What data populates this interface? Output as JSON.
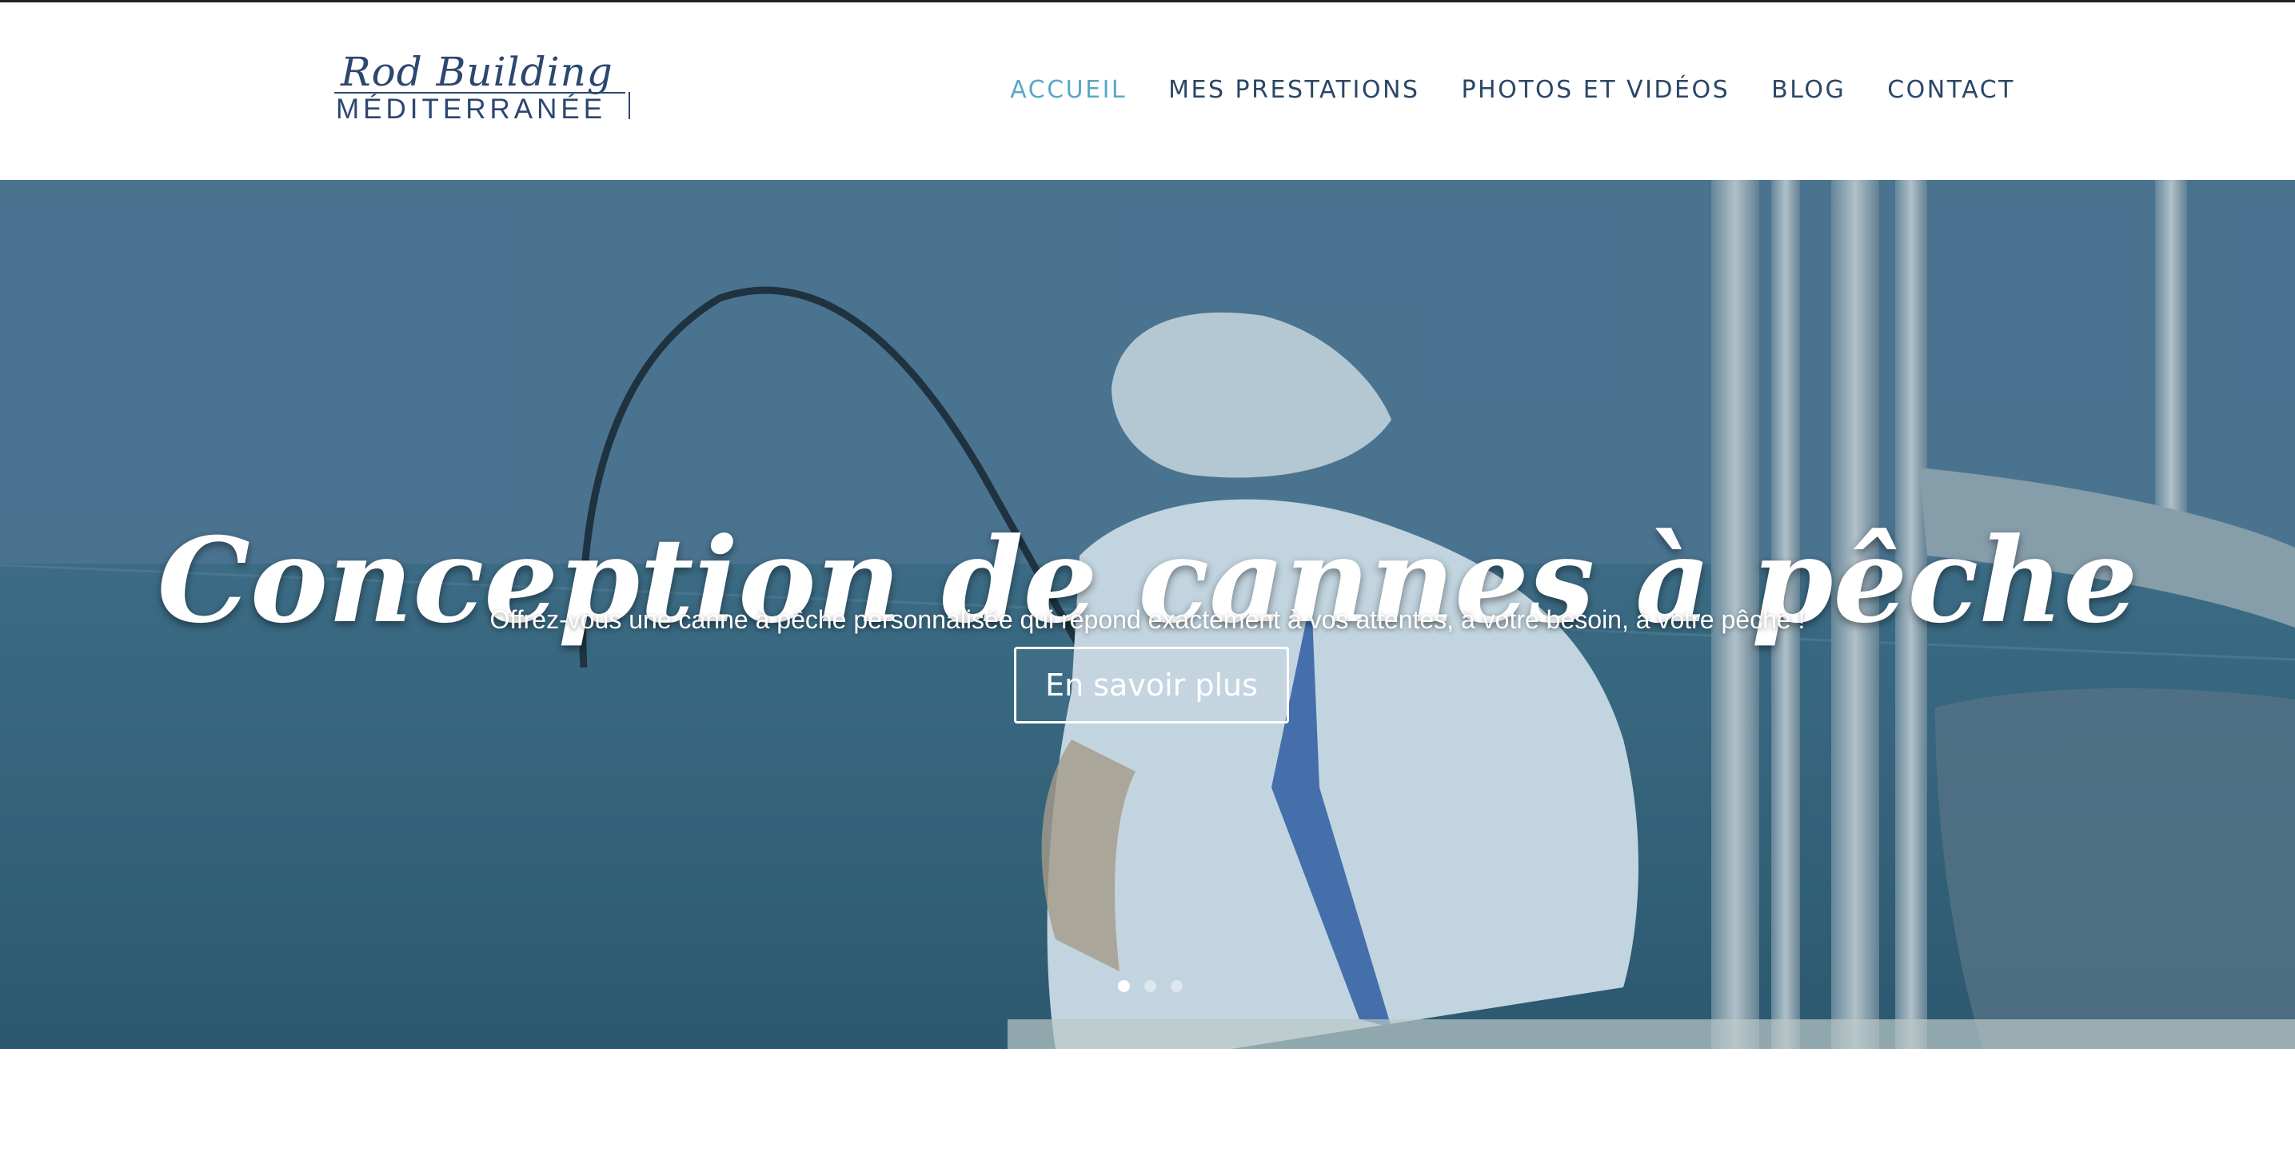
{
  "logo": {
    "script_text": "Rod Building",
    "sub_text": "MÉDITERRANÉE"
  },
  "nav": {
    "items": [
      {
        "label": "ACCUEIL",
        "active": true
      },
      {
        "label": "MES PRESTATIONS",
        "active": false
      },
      {
        "label": "PHOTOS ET VIDÉOS",
        "active": false
      },
      {
        "label": "BLOG",
        "active": false
      },
      {
        "label": "CONTACT",
        "active": false
      }
    ],
    "active_color": "#5aa8c8",
    "color": "#2b4766"
  },
  "hero": {
    "title": "Conception de cannes à pêche",
    "subtitle": "Offrez-vous une canne à pêche personnalisée qui répond exactement à vos attentes, à votre besoin, à votre pêche !",
    "button_label": "En savoir plus",
    "slides": [
      {
        "active": true
      },
      {
        "active": false
      },
      {
        "active": false
      }
    ]
  }
}
